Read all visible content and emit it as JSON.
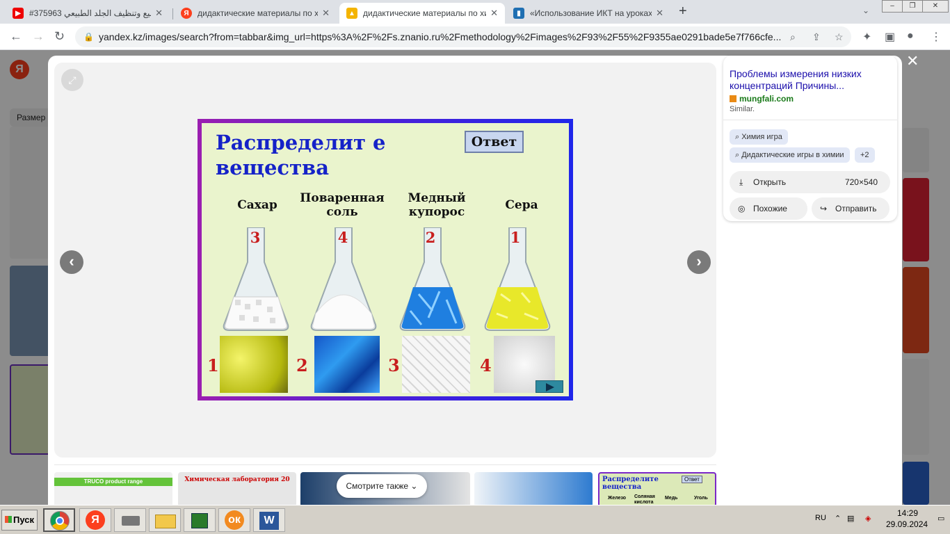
{
  "browser": {
    "tabs": [
      {
        "title": "#375963 تلميع وتنظيف الجلد الطبيعي",
        "icon": "youtube-icon",
        "close": "✕"
      },
      {
        "title": "дидактические материалы по химии",
        "icon": "yandex-icon",
        "close": "✕"
      },
      {
        "title": "дидактические материалы по химии",
        "icon": "image-tab-icon",
        "close": "✕"
      },
      {
        "title": "«Использование ИКТ на уроках химии",
        "icon": "book-icon",
        "close": "✕"
      }
    ],
    "new_tab": "+",
    "url": "yandex.kz/images/search?from=tabbar&img_url=https%3A%2F%2Fs.znanio.ru%2Fmethodology%2Fimages%2F93%2F55%2F9355ae0291bade5e7f766cfe..."
  },
  "page": {
    "yandex_logo": "Я",
    "size_filter": "Размер"
  },
  "viewer": {
    "prev": "‹",
    "next": "›",
    "close": "✕",
    "slide": {
      "title": "Распределит е вещества",
      "answer_button": "Ответ",
      "labels": [
        "Сахар",
        "Поваренная соль",
        "Медный купорос",
        "Сера"
      ],
      "flask_numbers": [
        "3",
        "4",
        "2",
        "1"
      ],
      "sample_numbers": [
        "1",
        "2",
        "3",
        "4"
      ]
    },
    "info": {
      "title": "Проблемы измерения низких концентраций Причины...",
      "site": "mungfali.com",
      "similar": "Similar.",
      "chips": [
        "Химия игра",
        "Дидактические игры в химии",
        "+2"
      ],
      "open_label": "Открыть",
      "open_size": "720×540",
      "similar_btn": "Похожие",
      "share_btn": "Отправить"
    },
    "see_also": "Смотрите также",
    "strip": {
      "trueo": "TRUCO product range",
      "lab": "Химическая лаборатория 20",
      "last_title": "Распределите вещества",
      "last_answer": "Ответ",
      "last_labels": [
        "Железо",
        "Соляная кислота",
        "Медь",
        "Уголь"
      ]
    }
  },
  "taskbar": {
    "start": "Пуск",
    "lang": "RU",
    "time": "14:29",
    "date": "29.09.2024"
  }
}
